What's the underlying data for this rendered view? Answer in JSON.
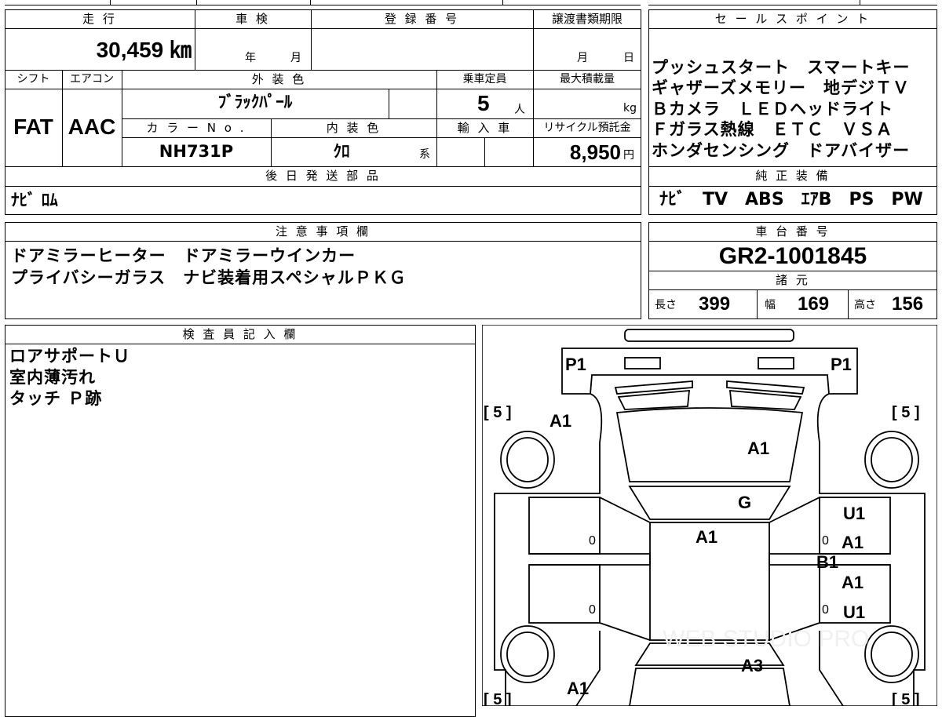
{
  "main_table": {
    "mileage_header": "走 行",
    "mileage_value": "30,459 ㎞",
    "inspection_header": "車 検",
    "inspection_year_unit": "年",
    "inspection_month_unit": "月",
    "registration_header": "登 録 番 号",
    "transfer_header": "譲渡書類期限",
    "transfer_month_unit": "月",
    "transfer_day_unit": "日",
    "shift_header": "シフト",
    "aircon_header": "エアコン",
    "exterior_header": "外 装 色",
    "capacity_header": "乗車定員",
    "maxload_header": "最大積載量",
    "shift_value": "FAT",
    "aircon_value": "AAC",
    "exterior_value": "ﾌﾞﾗｯｸﾊﾟｰﾙ",
    "capacity_value": "5",
    "capacity_unit": "人",
    "maxload_unit": "kg",
    "color_no_header": "カ ラ ー N o .",
    "interior_header": "内 装 色",
    "import_header": "輸 入 車",
    "recycle_header": "リサイクル預託金",
    "color_no_value": "NH731P",
    "interior_value": "ｸﾛ",
    "interior_unit": "系",
    "recycle_value": "8,950",
    "recycle_unit": "円",
    "later_parts_header": "後 日 発 送 部 品",
    "later_parts_value": "ﾅﾋﾞ ﾛﾑ"
  },
  "sales_points": {
    "header": "セ ー ル ス ポ イ ン ト",
    "lines": [
      "プッシュスタート　スマートキー",
      "ギャザーズメモリー　地デジＴＶ",
      "Ｂカメラ　ＬＥＤヘッドライト",
      "Ｆガラス熱線　ＥＴＣ　ＶＳＡ",
      "ホンダセンシング　ドアバイザー"
    ],
    "genuine_header": "純 正 装 備",
    "genuine_value": "ﾅﾋﾞ　TV　ABS　ｴｱB　PS　PW"
  },
  "notes": {
    "header": "注 意 事 項 欄",
    "lines": [
      "ドアミラーヒーター　ドアミラーウインカー",
      "プライバシーガラス　ナビ装着用スペシャルＰＫＧ"
    ]
  },
  "chassis": {
    "header": "車 台 番 号",
    "value": "GR2-1001845",
    "dims_header": "諸 元",
    "length_label": "長さ",
    "length_value": "399",
    "width_label": "幅",
    "width_value": "169",
    "height_label": "高さ",
    "height_value": "156"
  },
  "inspector": {
    "header": "検 査 員 記 入 欄",
    "lines": [
      "ロアサポートＵ",
      "室内薄汚れ",
      "タッチ Ｐ跡"
    ]
  },
  "diagram": {
    "marks": {
      "p1_left": "P1",
      "p1_right": "P1",
      "tire_fl": "[ 5 ]",
      "tire_fr": "[ 5 ]",
      "tire_rl": "[ 5 ]",
      "tire_rr": "[ 5 ]",
      "front_left_fender": "A1",
      "hood": "A1",
      "windshield": "G",
      "roof": "A1",
      "right_front_door_u": "U1",
      "right_front_door_a": "A1",
      "right_pillar": "B1",
      "right_rear_door_a": "A1",
      "right_rear_door_u": "U1",
      "rear_left_quarter": "A1",
      "rear_gate": "A3"
    },
    "zeros": [
      "0",
      "0",
      "0",
      "0"
    ],
    "watermark": "WEB STUDIO PRO"
  }
}
